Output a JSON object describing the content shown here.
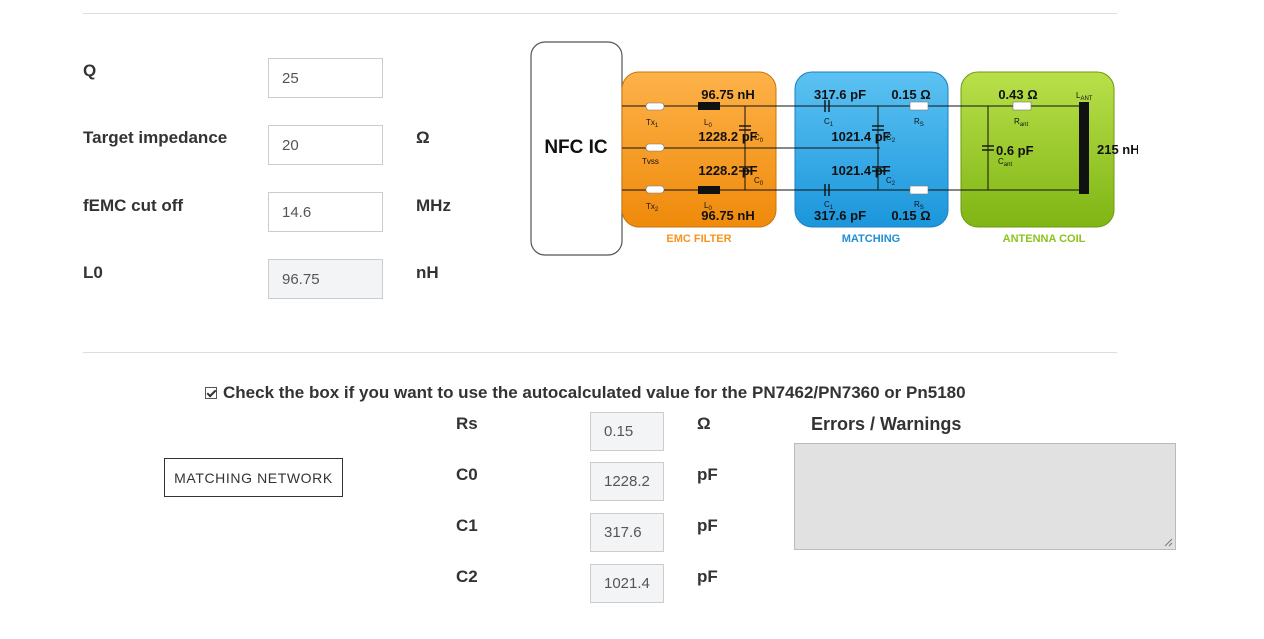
{
  "params": {
    "q": {
      "label": "Q",
      "value": "25"
    },
    "target": {
      "label": "Target impedance",
      "value": "20",
      "unit": "Ω"
    },
    "femc": {
      "label": "fEMC cut off",
      "value": "14.6",
      "unit": "MHz"
    },
    "l0": {
      "label": "L0",
      "value": "96.75",
      "unit": "nH"
    }
  },
  "diagram": {
    "ic": "NFC IC",
    "emc": {
      "caption": "EMC FILTER",
      "l0_top": "96.75 nH",
      "l0_bottom": "96.75 nH",
      "c0_top": "1228.2 pF",
      "c0_bottom": "1228.2 pF",
      "tx1": "Tx",
      "tx1_sub": "1",
      "tvss": "Tvss",
      "tx2": "Tx",
      "tx2_sub": "2",
      "l0_sym": "L",
      "l0_sym_sub": "0",
      "c0_sym": "C",
      "c0_sym_sub": "0"
    },
    "matching": {
      "caption": "MATCHING",
      "c1_top": "317.6 pF",
      "c1_bottom": "317.6 pF",
      "rs_top": "0.15 Ω",
      "rs_bottom": "0.15 Ω",
      "c2_top": "1021.4 pF",
      "c2_bottom": "1021.4 pF",
      "c1_sym": "C",
      "c1_sym_sub": "1",
      "rs_sym": "R",
      "rs_sym_sub": "S",
      "c2_sym": "C",
      "c2_sym_sub": "2"
    },
    "antenna": {
      "caption": "ANTENNA COIL",
      "rant": "0.43 Ω",
      "cant": "0.6 pF",
      "lant": "215 nH",
      "rant_sym": "R",
      "rant_sym_sub": "ant",
      "cant_sym": "C",
      "cant_sym_sub": "ant",
      "lant_sym": "L",
      "lant_sym_sub": "ANT"
    }
  },
  "autocalc": {
    "label": "Check the box if you want to use the autocalculated value for the PN7462/PN7360 or Pn5180",
    "checked": true
  },
  "button": {
    "label": "MATCHING NETWORK"
  },
  "results": {
    "rs": {
      "label": "Rs",
      "value": "0.15",
      "unit": "Ω"
    },
    "c0": {
      "label": "C0",
      "value": "1228.2",
      "unit": "pF"
    },
    "c1": {
      "label": "C1",
      "value": "317.6",
      "unit": "pF"
    },
    "c2": {
      "label": "C2",
      "value": "1021.4",
      "unit": "pF"
    }
  },
  "errors": {
    "label": "Errors / Warnings",
    "value": ""
  },
  "colors": {
    "emc": "#f7941d",
    "matching": "#29a8e8",
    "antenna": "#8dc21f",
    "emc_caption": "#f7941d",
    "matching_caption": "#1f8fd6",
    "antenna_caption": "#8dc21f"
  }
}
